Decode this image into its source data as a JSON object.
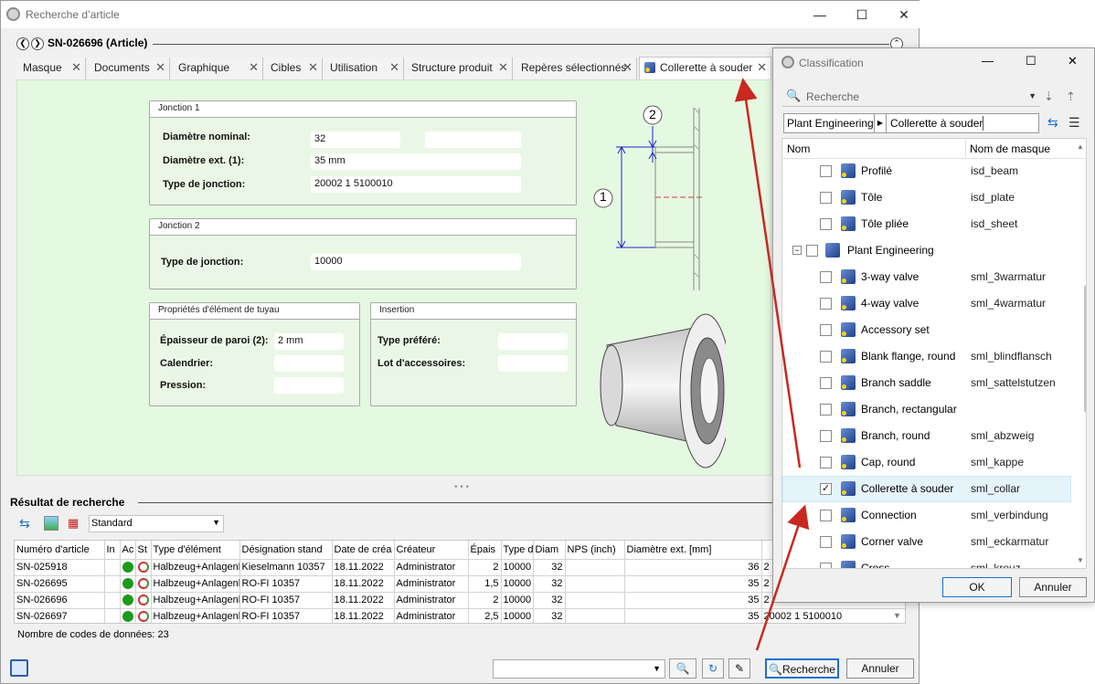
{
  "main_window": {
    "title": "Recherche d’article",
    "minimize": "—",
    "maximize": "☐",
    "close": "✕",
    "article_title": "SN-026696 (Article)",
    "tabs": [
      {
        "label": "Masque"
      },
      {
        "label": "Documents"
      },
      {
        "label": "Graphique"
      },
      {
        "label": "Cibles"
      },
      {
        "label": "Utilisation"
      },
      {
        "label": "Structure produit"
      },
      {
        "label": "Repères sélectionnés"
      },
      {
        "label": "Collerette à souder"
      }
    ],
    "tab_close": "✕"
  },
  "form": {
    "jonction1": {
      "title": "Jonction 1",
      "diam_nominal_label": "Diamètre nominal:",
      "diam_nominal_value": "32",
      "diam_ext_label": "Diamètre ext. (1):",
      "diam_ext_value": "35 mm",
      "type_label": "Type de jonction:",
      "type_value": "20002 1 5100010"
    },
    "jonction2": {
      "title": "Jonction 2",
      "type_label": "Type de jonction:",
      "type_value": "10000"
    },
    "proprietes": {
      "title": "Propriétés d'élément de tuyau",
      "epaisseur_label": "Épaisseur de paroi (2):",
      "epaisseur_value": "2 mm",
      "calendrier_label": "Calendrier:",
      "pression_label": "Pression:"
    },
    "insertion": {
      "title": "Insertion",
      "type_pref_label": "Type préféré:",
      "lot_label": "Lot d'accessoires:"
    },
    "drawing_label_1": "1",
    "drawing_label_2": "2"
  },
  "results": {
    "title": "Résultat de recherche",
    "view_value": "Standard",
    "columns": [
      "Numéro d'article",
      "In",
      "Ac",
      "St",
      "Type d'élément",
      "Désignation stand",
      "Date de créa",
      "Créateur",
      "Épais",
      "Type d",
      "Diam",
      "NPS (inch)",
      "Diamètre ext. [mm]"
    ],
    "rows": [
      {
        "num": "SN-025918",
        "type": "Halbzeug+Anlagenl",
        "desig": "Kieselmann 10357",
        "date": "18.11.2022",
        "creator": "Administrator",
        "ep": "2",
        "typej": "10000",
        "diam": "32",
        "nps": "",
        "dext": "36",
        "extra": "2"
      },
      {
        "num": "SN-026695",
        "type": "Halbzeug+Anlagenl",
        "desig": "RO-FI 10357",
        "date": "18.11.2022",
        "creator": "Administrator",
        "ep": "1,5",
        "typej": "10000",
        "diam": "32",
        "nps": "",
        "dext": "35",
        "extra": "2"
      },
      {
        "num": "SN-026696",
        "type": "Halbzeug+Anlagenl",
        "desig": "RO-FI 10357",
        "date": "18.11.2022",
        "creator": "Administrator",
        "ep": "2",
        "typej": "10000",
        "diam": "32",
        "nps": "",
        "dext": "35",
        "extra": "2"
      },
      {
        "num": "SN-026697",
        "type": "Halbzeug+Anlagenl",
        "desig": "RO-FI 10357",
        "date": "18.11.2022",
        "creator": "Administrator",
        "ep": "2,5",
        "typej": "10000",
        "diam": "32",
        "nps": "",
        "dext": "35",
        "extra": "20002 1 5100010"
      }
    ],
    "count_label": "Nombre de codes de données:",
    "count_value": "23"
  },
  "bottom": {
    "search_button": "Recherche",
    "cancel_button": "Annuler"
  },
  "dialog": {
    "title": "Classification",
    "minimize": "—",
    "maximize": "☐",
    "close": "✕",
    "search_placeholder": "Recherche",
    "crumb_1": "Plant Engineering",
    "crumb_2": "Collerette à souder",
    "col_name": "Nom",
    "col_mask": "Nom de masque",
    "items": [
      {
        "name": "Profilé",
        "mask": "isd_beam",
        "checked": false,
        "kind": "leaf"
      },
      {
        "name": "Tôle",
        "mask": "isd_plate",
        "checked": false,
        "kind": "leaf"
      },
      {
        "name": "Tôle pliée",
        "mask": "isd_sheet",
        "checked": false,
        "kind": "leaf"
      },
      {
        "name": "Plant Engineering",
        "mask": "",
        "checked": false,
        "kind": "folder"
      },
      {
        "name": "3-way valve",
        "mask": "sml_3warmatur",
        "checked": false,
        "kind": "leaf"
      },
      {
        "name": "4-way valve",
        "mask": "sml_4warmatur",
        "checked": false,
        "kind": "leaf"
      },
      {
        "name": "Accessory set",
        "mask": "",
        "checked": false,
        "kind": "leaf"
      },
      {
        "name": "Blank flange, round",
        "mask": "sml_blindflansch",
        "checked": false,
        "kind": "leaf"
      },
      {
        "name": "Branch saddle",
        "mask": "sml_sattelstutzen",
        "checked": false,
        "kind": "leaf"
      },
      {
        "name": "Branch, rectangular",
        "mask": "",
        "checked": false,
        "kind": "leaf"
      },
      {
        "name": "Branch, round",
        "mask": "sml_abzweig",
        "checked": false,
        "kind": "leaf"
      },
      {
        "name": "Cap, round",
        "mask": "sml_kappe",
        "checked": false,
        "kind": "leaf"
      },
      {
        "name": "Collerette à souder",
        "mask": "sml_collar",
        "checked": true,
        "kind": "leaf"
      },
      {
        "name": "Connection",
        "mask": "sml_verbindung",
        "checked": false,
        "kind": "leaf"
      },
      {
        "name": "Corner valve",
        "mask": "sml_eckarmatur",
        "checked": false,
        "kind": "leaf"
      },
      {
        "name": "Cross",
        "mask": "sml_kreuz",
        "checked": false,
        "kind": "leaf"
      }
    ],
    "ok_button": "OK",
    "cancel_button": "Annuler"
  },
  "colors": {
    "panel_bg": "#e5f8e1",
    "arrow": "#c8281f",
    "selection": "#e5f3fb"
  }
}
